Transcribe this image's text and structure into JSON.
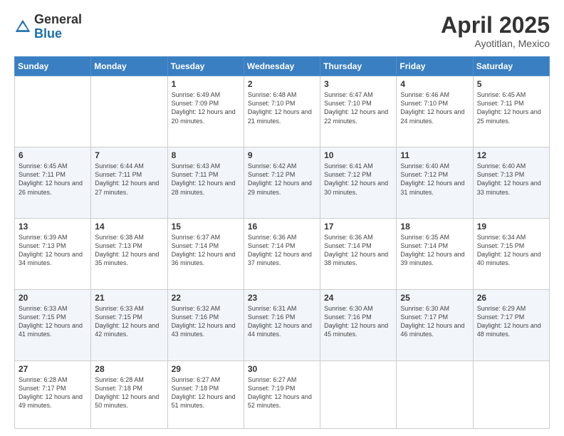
{
  "header": {
    "logo_general": "General",
    "logo_blue": "Blue",
    "month_year": "April 2025",
    "location": "Ayotitlan, Mexico"
  },
  "days_of_week": [
    "Sunday",
    "Monday",
    "Tuesday",
    "Wednesday",
    "Thursday",
    "Friday",
    "Saturday"
  ],
  "weeks": [
    [
      {
        "day": "",
        "info": ""
      },
      {
        "day": "",
        "info": ""
      },
      {
        "day": "1",
        "info": "Sunrise: 6:49 AM\nSunset: 7:09 PM\nDaylight: 12 hours and 20 minutes."
      },
      {
        "day": "2",
        "info": "Sunrise: 6:48 AM\nSunset: 7:10 PM\nDaylight: 12 hours and 21 minutes."
      },
      {
        "day": "3",
        "info": "Sunrise: 6:47 AM\nSunset: 7:10 PM\nDaylight: 12 hours and 22 minutes."
      },
      {
        "day": "4",
        "info": "Sunrise: 6:46 AM\nSunset: 7:10 PM\nDaylight: 12 hours and 24 minutes."
      },
      {
        "day": "5",
        "info": "Sunrise: 6:45 AM\nSunset: 7:11 PM\nDaylight: 12 hours and 25 minutes."
      }
    ],
    [
      {
        "day": "6",
        "info": "Sunrise: 6:45 AM\nSunset: 7:11 PM\nDaylight: 12 hours and 26 minutes."
      },
      {
        "day": "7",
        "info": "Sunrise: 6:44 AM\nSunset: 7:11 PM\nDaylight: 12 hours and 27 minutes."
      },
      {
        "day": "8",
        "info": "Sunrise: 6:43 AM\nSunset: 7:11 PM\nDaylight: 12 hours and 28 minutes."
      },
      {
        "day": "9",
        "info": "Sunrise: 6:42 AM\nSunset: 7:12 PM\nDaylight: 12 hours and 29 minutes."
      },
      {
        "day": "10",
        "info": "Sunrise: 6:41 AM\nSunset: 7:12 PM\nDaylight: 12 hours and 30 minutes."
      },
      {
        "day": "11",
        "info": "Sunrise: 6:40 AM\nSunset: 7:12 PM\nDaylight: 12 hours and 31 minutes."
      },
      {
        "day": "12",
        "info": "Sunrise: 6:40 AM\nSunset: 7:13 PM\nDaylight: 12 hours and 33 minutes."
      }
    ],
    [
      {
        "day": "13",
        "info": "Sunrise: 6:39 AM\nSunset: 7:13 PM\nDaylight: 12 hours and 34 minutes."
      },
      {
        "day": "14",
        "info": "Sunrise: 6:38 AM\nSunset: 7:13 PM\nDaylight: 12 hours and 35 minutes."
      },
      {
        "day": "15",
        "info": "Sunrise: 6:37 AM\nSunset: 7:14 PM\nDaylight: 12 hours and 36 minutes."
      },
      {
        "day": "16",
        "info": "Sunrise: 6:36 AM\nSunset: 7:14 PM\nDaylight: 12 hours and 37 minutes."
      },
      {
        "day": "17",
        "info": "Sunrise: 6:36 AM\nSunset: 7:14 PM\nDaylight: 12 hours and 38 minutes."
      },
      {
        "day": "18",
        "info": "Sunrise: 6:35 AM\nSunset: 7:14 PM\nDaylight: 12 hours and 39 minutes."
      },
      {
        "day": "19",
        "info": "Sunrise: 6:34 AM\nSunset: 7:15 PM\nDaylight: 12 hours and 40 minutes."
      }
    ],
    [
      {
        "day": "20",
        "info": "Sunrise: 6:33 AM\nSunset: 7:15 PM\nDaylight: 12 hours and 41 minutes."
      },
      {
        "day": "21",
        "info": "Sunrise: 6:33 AM\nSunset: 7:15 PM\nDaylight: 12 hours and 42 minutes."
      },
      {
        "day": "22",
        "info": "Sunrise: 6:32 AM\nSunset: 7:16 PM\nDaylight: 12 hours and 43 minutes."
      },
      {
        "day": "23",
        "info": "Sunrise: 6:31 AM\nSunset: 7:16 PM\nDaylight: 12 hours and 44 minutes."
      },
      {
        "day": "24",
        "info": "Sunrise: 6:30 AM\nSunset: 7:16 PM\nDaylight: 12 hours and 45 minutes."
      },
      {
        "day": "25",
        "info": "Sunrise: 6:30 AM\nSunset: 7:17 PM\nDaylight: 12 hours and 46 minutes."
      },
      {
        "day": "26",
        "info": "Sunrise: 6:29 AM\nSunset: 7:17 PM\nDaylight: 12 hours and 48 minutes."
      }
    ],
    [
      {
        "day": "27",
        "info": "Sunrise: 6:28 AM\nSunset: 7:17 PM\nDaylight: 12 hours and 49 minutes."
      },
      {
        "day": "28",
        "info": "Sunrise: 6:28 AM\nSunset: 7:18 PM\nDaylight: 12 hours and 50 minutes."
      },
      {
        "day": "29",
        "info": "Sunrise: 6:27 AM\nSunset: 7:18 PM\nDaylight: 12 hours and 51 minutes."
      },
      {
        "day": "30",
        "info": "Sunrise: 6:27 AM\nSunset: 7:19 PM\nDaylight: 12 hours and 52 minutes."
      },
      {
        "day": "",
        "info": ""
      },
      {
        "day": "",
        "info": ""
      },
      {
        "day": "",
        "info": ""
      }
    ]
  ]
}
